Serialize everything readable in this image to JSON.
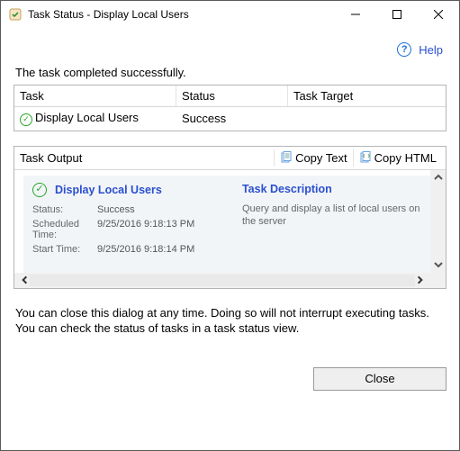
{
  "window": {
    "title": "Task Status - Display Local Users"
  },
  "help": {
    "label": "Help"
  },
  "summary": "The task completed successfully.",
  "table": {
    "headers": {
      "task": "Task",
      "status": "Status",
      "target": "Task Target"
    },
    "row": {
      "task": "Display Local Users",
      "status": "Success",
      "target": ""
    }
  },
  "output": {
    "label": "Task Output",
    "copy_text": "Copy Text",
    "copy_html": "Copy HTML",
    "task_name": "Display Local Users",
    "fields": {
      "status_label": "Status:",
      "status_value": "Success",
      "scheduled_label": "Scheduled Time:",
      "scheduled_value": "9/25/2016 9:18:13 PM",
      "start_label": "Start Time:",
      "start_value": "9/25/2016 9:18:14 PM"
    },
    "desc_head": "Task Description",
    "desc_text": "Query and display a list of local users on the server"
  },
  "info": "You can close this dialog at any time. Doing so will not interrupt executing tasks. You can check the status of tasks in a task status view.",
  "footer": {
    "close": "Close"
  }
}
